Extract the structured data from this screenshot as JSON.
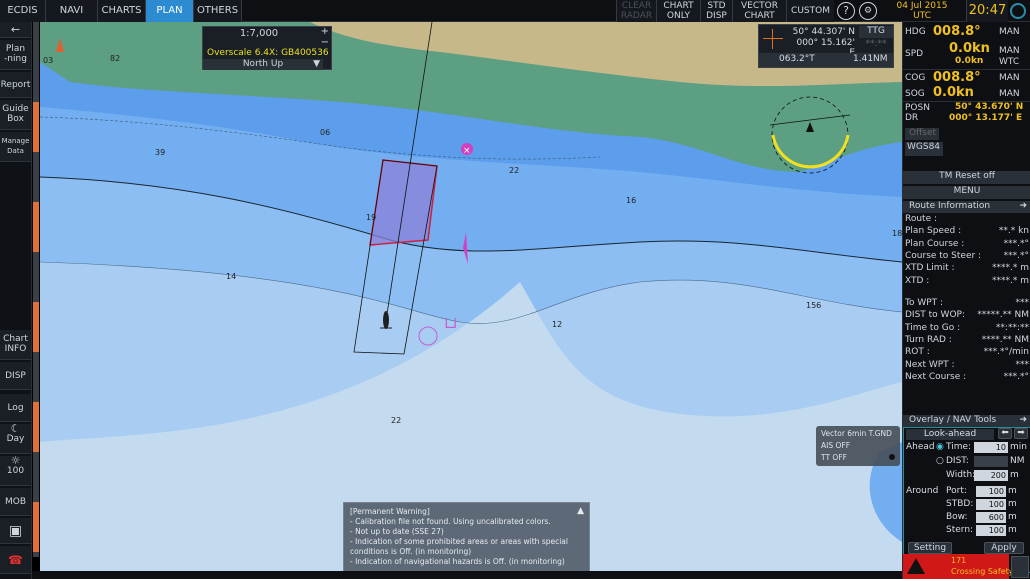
{
  "tabs": [
    {
      "label": "ECDIS"
    },
    {
      "label": "NAVI"
    },
    {
      "label": "CHARTS"
    },
    {
      "label": "PLAN"
    },
    {
      "label": "OTHERS"
    }
  ],
  "top_buttons": {
    "clear_radar": [
      "CLEAR",
      "RADAR"
    ],
    "chart_only": [
      "CHART",
      "ONLY"
    ],
    "std_disp": [
      "STD",
      "DISP"
    ],
    "vector_chart": [
      "VECTOR",
      "CHART"
    ],
    "custom": "CUSTOM",
    "help": "?"
  },
  "date": [
    "04 Jul 2015",
    "UTC"
  ],
  "time": "20:47",
  "left_sidebar": {
    "back": "←",
    "planning": [
      "Plan",
      "-ning"
    ],
    "report": "Report",
    "guide_box": [
      "Guide",
      "Box"
    ],
    "manage_data": [
      "Manage",
      "Data"
    ],
    "chart_info": [
      "Chart",
      "INFO"
    ],
    "disp": "DISP",
    "log": "Log",
    "day": "Day",
    "brightness": "100",
    "mob": "MOB"
  },
  "scale_box": {
    "scale": "1:7,000",
    "plus": "+",
    "minus": "−",
    "overscale": "Overscale 6.4X: GB400536",
    "orientation": "North  Up"
  },
  "cursor_box": {
    "lat": "50° 44.307' N",
    "lon": "000° 15.162' E",
    "ttg_label": "TTG",
    "ttg_value": "**:**",
    "bearing": "063.2°T",
    "range": "1.41NM"
  },
  "depths": [
    {
      "v": "03"
    },
    {
      "v": "82"
    },
    {
      "v": "06"
    },
    {
      "v": "39"
    },
    {
      "v": "22"
    },
    {
      "v": "16"
    },
    {
      "v": "19"
    },
    {
      "v": "14"
    },
    {
      "v": "12"
    },
    {
      "v": "156"
    },
    {
      "v": "18"
    },
    {
      "v": "22"
    }
  ],
  "warning": {
    "title": "[Permanent Warning]",
    "lines": [
      "- Calibration file not found. Using uncalibrated colors.",
      "- Not up to date (SSE 27)",
      "- Indication of some prohibited areas or areas with special",
      "conditions is Off. (in monitoring)",
      "- Indication of navigational hazards is Off. (in monitoring)"
    ]
  },
  "vector_box": {
    "vector": "Vector 6min T.GND",
    "ais": "AIS OFF",
    "tt": "TT OFF"
  },
  "right_panel": {
    "hdg_label": "HDG",
    "hdg_value": "008.8°",
    "hdg_mode": "MAN",
    "spd_label": "SPD",
    "spd_value": "0.0kn",
    "spd_sub": "0.0kn",
    "spd_mode": [
      "MAN",
      "WTC"
    ],
    "cog_label": "COG",
    "cog_value": "008.8°",
    "cog_mode": "MAN",
    "sog_label": "SOG",
    "sog_value": "0.0kn",
    "sog_mode": "MAN",
    "posn_label": [
      "POSN",
      "DR"
    ],
    "posn_lat": "50° 43.670' N",
    "posn_lon": "000° 13.177' E",
    "offset": "Offset",
    "datum": "WGS84",
    "tm_reset": "TM Reset off",
    "menu": "MENU",
    "route_info_title": "Route Information",
    "route_rows": [
      {
        "label": "Route :",
        "value": ""
      },
      {
        "label": "Plan Speed :",
        "value": "**.* kn"
      },
      {
        "label": "Plan Course :",
        "value": "***.*°"
      },
      {
        "label": "Course to Steer :",
        "value": "***.*°"
      },
      {
        "label": "XTD Limit :",
        "value": "****.* m"
      },
      {
        "label": "XTD :",
        "value": "****.* m"
      }
    ],
    "wpt_rows": [
      {
        "label": "To WPT :",
        "value": "***"
      },
      {
        "label": "DIST to WOP:",
        "value": "*****.** NM"
      },
      {
        "label": "Time to Go :",
        "value": "**:**:**"
      },
      {
        "label": "Turn RAD :",
        "value": "****.** NM"
      },
      {
        "label": "ROT :",
        "value": "***.*°/min"
      },
      {
        "label": "Next WPT :",
        "value": "***"
      },
      {
        "label": "Next Course :",
        "value": "***.*°"
      }
    ],
    "overlay_title": "Overlay / NAV Tools",
    "lookahead_title": "Look-ahead",
    "ahead_label": "Ahead",
    "time_label": "Time:",
    "time_value": "10",
    "time_unit": "min",
    "dist_label": "DIST:",
    "dist_unit": "NM",
    "width_label": "Width:",
    "width_value": "200",
    "width_unit": "m",
    "around_label": "Around",
    "port_label": "Port:",
    "port_value": "100",
    "stbd_label": "STBD:",
    "stbd_value": "100",
    "bow_label": "Bow:",
    "bow_value": "600",
    "stern_label": "Stern:",
    "stern_value": "100",
    "unit_m": "m",
    "setting": "Setting",
    "apply": "Apply",
    "alarm_code": "171",
    "alarm_text": "Crossing Safety..."
  }
}
